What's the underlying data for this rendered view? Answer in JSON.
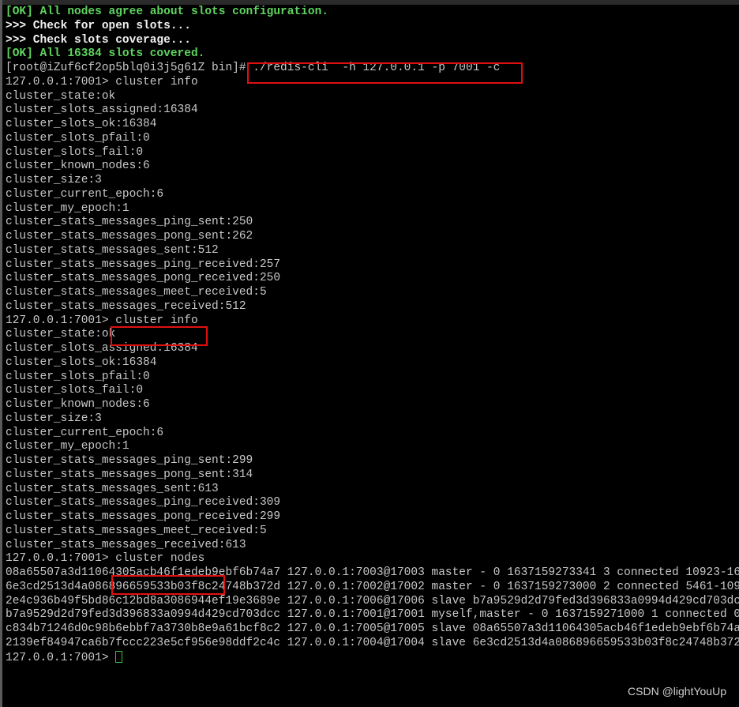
{
  "colors": {
    "ok_text": "#5fd35f",
    "normal_text": "#c8c8c8",
    "highlight_box": "#e01010",
    "background": "#000000"
  },
  "lines": [
    {
      "text": "[OK] All nodes agree about slots configuration.",
      "style": "green"
    },
    {
      "text": ">>> Check for open slots...",
      "style": "white"
    },
    {
      "text": ">>> Check slots coverage...",
      "style": "white"
    },
    {
      "text": "[OK] All 16384 slots covered.",
      "style": "green"
    },
    {
      "text": "[root@iZuf6cf2op5blq0i3j5g61Z bin]# ./redis-cli  -h 127.0.0.1 -p 7001 -c",
      "style": ""
    },
    {
      "text": "127.0.0.1:7001> cluster info",
      "style": ""
    },
    {
      "text": "cluster_state:ok",
      "style": ""
    },
    {
      "text": "cluster_slots_assigned:16384",
      "style": ""
    },
    {
      "text": "cluster_slots_ok:16384",
      "style": ""
    },
    {
      "text": "cluster_slots_pfail:0",
      "style": ""
    },
    {
      "text": "cluster_slots_fail:0",
      "style": ""
    },
    {
      "text": "cluster_known_nodes:6",
      "style": ""
    },
    {
      "text": "cluster_size:3",
      "style": ""
    },
    {
      "text": "cluster_current_epoch:6",
      "style": ""
    },
    {
      "text": "cluster_my_epoch:1",
      "style": ""
    },
    {
      "text": "cluster_stats_messages_ping_sent:250",
      "style": ""
    },
    {
      "text": "cluster_stats_messages_pong_sent:262",
      "style": ""
    },
    {
      "text": "cluster_stats_messages_sent:512",
      "style": ""
    },
    {
      "text": "cluster_stats_messages_ping_received:257",
      "style": ""
    },
    {
      "text": "cluster_stats_messages_pong_received:250",
      "style": ""
    },
    {
      "text": "cluster_stats_messages_meet_received:5",
      "style": ""
    },
    {
      "text": "cluster_stats_messages_received:512",
      "style": ""
    },
    {
      "text": "127.0.0.1:7001> cluster info",
      "style": ""
    },
    {
      "text": "cluster_state:ok",
      "style": ""
    },
    {
      "text": "cluster_slots_assigned:16384",
      "style": ""
    },
    {
      "text": "cluster_slots_ok:16384",
      "style": ""
    },
    {
      "text": "cluster_slots_pfail:0",
      "style": ""
    },
    {
      "text": "cluster_slots_fail:0",
      "style": ""
    },
    {
      "text": "cluster_known_nodes:6",
      "style": ""
    },
    {
      "text": "cluster_size:3",
      "style": ""
    },
    {
      "text": "cluster_current_epoch:6",
      "style": ""
    },
    {
      "text": "cluster_my_epoch:1",
      "style": ""
    },
    {
      "text": "cluster_stats_messages_ping_sent:299",
      "style": ""
    },
    {
      "text": "cluster_stats_messages_pong_sent:314",
      "style": ""
    },
    {
      "text": "cluster_stats_messages_sent:613",
      "style": ""
    },
    {
      "text": "cluster_stats_messages_ping_received:309",
      "style": ""
    },
    {
      "text": "cluster_stats_messages_pong_received:299",
      "style": ""
    },
    {
      "text": "cluster_stats_messages_meet_received:5",
      "style": ""
    },
    {
      "text": "cluster_stats_messages_received:613",
      "style": ""
    },
    {
      "text": "127.0.0.1:7001> cluster nodes",
      "style": ""
    },
    {
      "text": "08a65507a3d11064305acb46f1edeb9ebf6b74a7 127.0.0.1:7003@17003 master - 0 1637159273341 3 connected 10923-16",
      "style": ""
    },
    {
      "text": "6e3cd2513d4a086896659533b03f8c24748b372d 127.0.0.1:7002@17002 master - 0 1637159273000 2 connected 5461-109",
      "style": ""
    },
    {
      "text": "2e4c936b49f5bd86c12bd8a3086944ef19e3689e 127.0.0.1:7006@17006 slave b7a9529d2d79fed3d396833a0994d429cd703dc",
      "style": ""
    },
    {
      "text": "b7a9529d2d79fed3d396833a0994d429cd703dcc 127.0.0.1:7001@17001 myself,master - 0 1637159271000 1 connected 0",
      "style": ""
    },
    {
      "text": "c834b71246d0c98b6ebbf7a3730b8e9a61bcf8c2 127.0.0.1:7005@17005 slave 08a65507a3d11064305acb46f1edeb9ebf6b74a",
      "style": ""
    },
    {
      "text": "2139ef84947ca6b7fccc223e5cf956e98ddf2c4c 127.0.0.1:7004@17004 slave 6e3cd2513d4a086896659533b03f8c24748b372",
      "style": ""
    }
  ],
  "prompt": "127.0.0.1:7001> ",
  "watermark": "CSDN @lightYouUp"
}
